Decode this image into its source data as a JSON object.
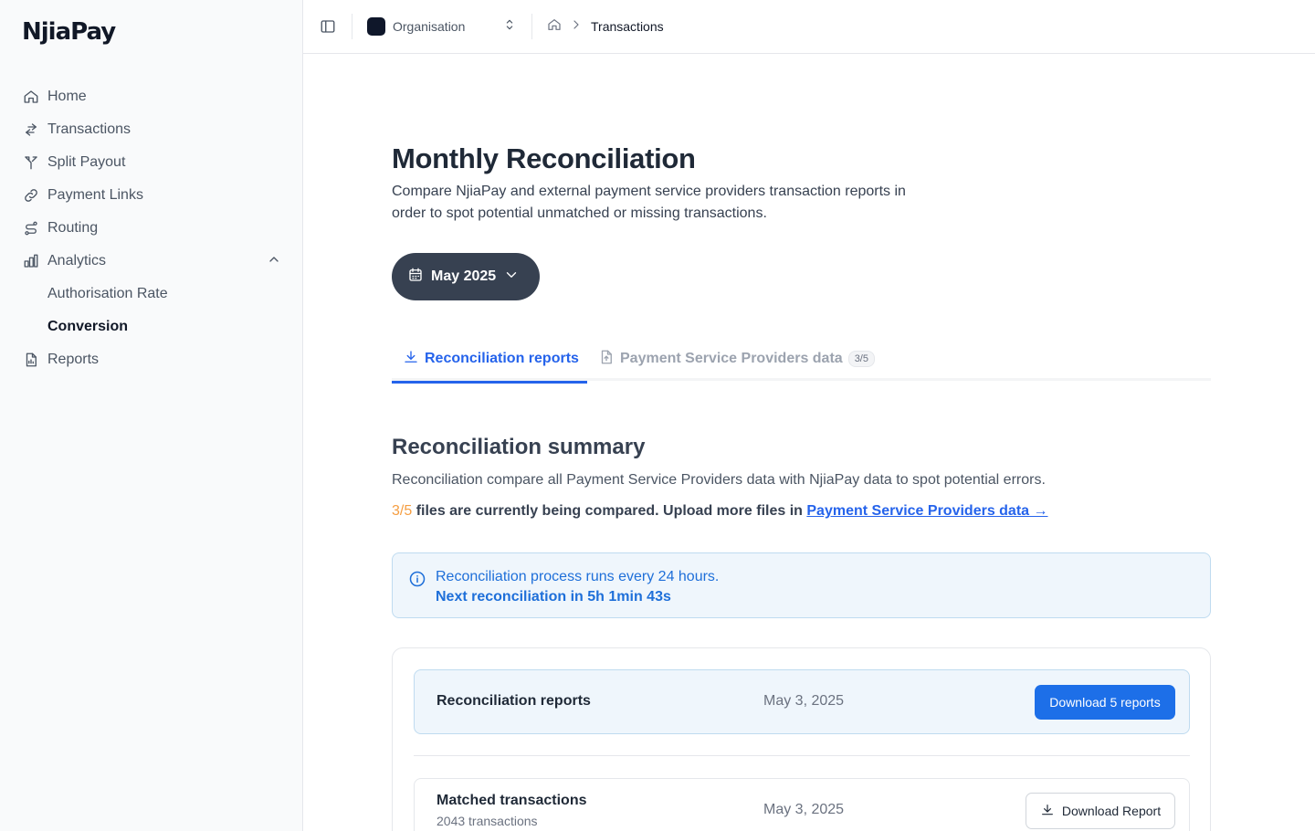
{
  "app": {
    "logo": "NjiaPay"
  },
  "sidebar": {
    "items": [
      {
        "label": "Home",
        "icon": "home-icon"
      },
      {
        "label": "Transactions",
        "icon": "arrows-exchange-icon"
      },
      {
        "label": "Split Payout",
        "icon": "split-icon"
      },
      {
        "label": "Payment Links",
        "icon": "link-icon"
      },
      {
        "label": "Routing",
        "icon": "route-icon"
      },
      {
        "label": "Analytics",
        "icon": "bar-chart-icon",
        "expanded": true,
        "children": [
          {
            "label": "Authorisation Rate",
            "active": false
          },
          {
            "label": "Conversion",
            "active": true
          }
        ]
      },
      {
        "label": "Reports",
        "icon": "report-file-icon"
      }
    ]
  },
  "topbar": {
    "org_label": "Organisation",
    "breadcrumb_current": "Transactions"
  },
  "page": {
    "title": "Monthly Reconciliation",
    "description": "Compare NjiaPay and external payment service providers transaction reports in order to spot potential unmatched or missing transactions.",
    "month_selector": "May 2025"
  },
  "tabs": [
    {
      "label": "Reconciliation reports",
      "active": true,
      "icon": "download-icon"
    },
    {
      "label": "Payment Service Providers data",
      "active": false,
      "icon": "file-upload-icon",
      "badge": "3/5"
    }
  ],
  "summary": {
    "title": "Reconciliation summary",
    "description": "Reconciliation compare all Payment Service Providers data with NjiaPay data to spot potential errors.",
    "files_count": "3/5",
    "files_text": " files are currently being compared. Upload more files in ",
    "files_link": "Payment Service Providers data →"
  },
  "info_banner": {
    "line1": "Reconciliation process runs every 24 hours.",
    "line2": "Next reconciliation in 5h 1min 43s"
  },
  "reports": [
    {
      "name": "Reconciliation reports",
      "date": "May 3, 2025",
      "action": "Download 5 reports"
    },
    {
      "name": "Matched transactions",
      "subtitle": "2043 transactions",
      "date": "May 3, 2025",
      "action": "Download Report"
    }
  ],
  "colors": {
    "accent": "#2563eb",
    "sidebar_bg": "#f9fafb",
    "month_button_bg": "#374151",
    "info_bg": "#eff6fc",
    "count_orange": "#f59e42"
  }
}
